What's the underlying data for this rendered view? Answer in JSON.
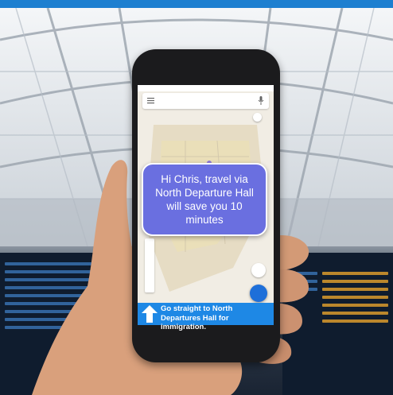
{
  "scene": {
    "description_icon": "smartphone-in-hand",
    "accent_color": "#1d7fd0"
  },
  "map_app": {
    "search": {
      "placeholder": ""
    },
    "icons": [
      "menu-icon",
      "mic-icon",
      "compass-icon",
      "my-location-icon",
      "navigation-fab-icon"
    ]
  },
  "message_bubble": {
    "text": "Hi Chris, travel via North Departure Hall will save you 10 minutes",
    "color": "#6a6fe0"
  },
  "navigation": {
    "instruction": "Go straight to North Departures Hall for immigration.",
    "arrow_icon": "straight-arrow-icon",
    "color": "#1e88e5"
  }
}
